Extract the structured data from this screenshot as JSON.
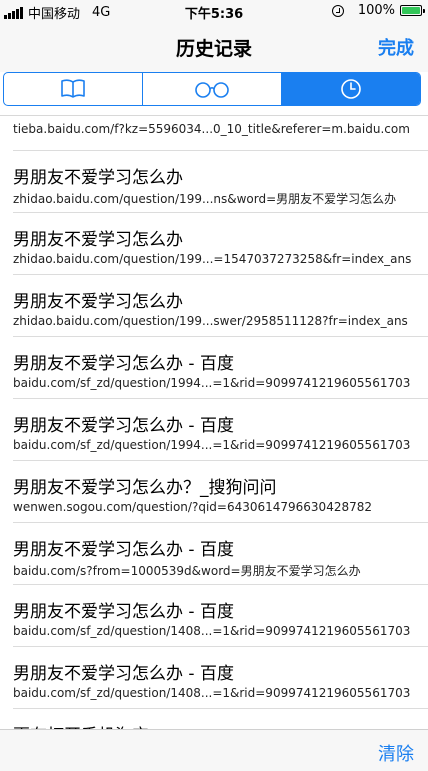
{
  "status_bar": {
    "carrier": "中国移动",
    "network": "4G",
    "time": "下午5:36",
    "battery": "100%"
  },
  "nav": {
    "title": "历史记录",
    "done_label": "完成"
  },
  "tabs": [
    {
      "icon": "bookmarks-book-icon",
      "active": false
    },
    {
      "icon": "reading-list-glasses-icon",
      "active": false
    },
    {
      "icon": "history-clock-icon",
      "active": true
    }
  ],
  "history": {
    "first_url": "tieba.baidu.com/f?kz=5596034...0_10_title&referer=m.baidu.com",
    "items": [
      {
        "title": "男朋友不爱学习怎么办",
        "url": "zhidao.baidu.com/question/199...ns&word=男朋友不爱学习怎么办"
      },
      {
        "title": "男朋友不爱学习怎么办",
        "url": "zhidao.baidu.com/question/199...=1547037273258&fr=index_ans"
      },
      {
        "title": "男朋友不爱学习怎么办",
        "url": "zhidao.baidu.com/question/199...swer/2958511128?fr=index_ans"
      },
      {
        "title": "男朋友不爱学习怎么办 - 百度",
        "url": "baidu.com/sf_zd/question/1994...=1&rid=9099741219605561703"
      },
      {
        "title": "男朋友不爱学习怎么办 - 百度",
        "url": "baidu.com/sf_zd/question/1994...=1&rid=9099741219605561703"
      },
      {
        "title": "男朋友不爱学习怎么办？_搜狗问问",
        "url": "wenwen.sogou.com/question/?qid=6430614796630428782"
      },
      {
        "title": "男朋友不爱学习怎么办 - 百度",
        "url": "baidu.com/s?from=1000539d&word=男朋友不爱学习怎么办"
      },
      {
        "title": "男朋友不爱学习怎么办 - 百度",
        "url": "baidu.com/sf_zd/question/1408...=1&rid=9099741219605561703"
      },
      {
        "title": "男朋友不爱学习怎么办 - 百度",
        "url": "baidu.com/sf_zd/question/1408...=1&rid=9099741219605561703"
      }
    ],
    "partial_title": "更有打开手机淘宝"
  },
  "toolbar": {
    "clear_label": "清除"
  },
  "colors": {
    "accent": "#1a7ff0",
    "battery": "#33c659"
  }
}
